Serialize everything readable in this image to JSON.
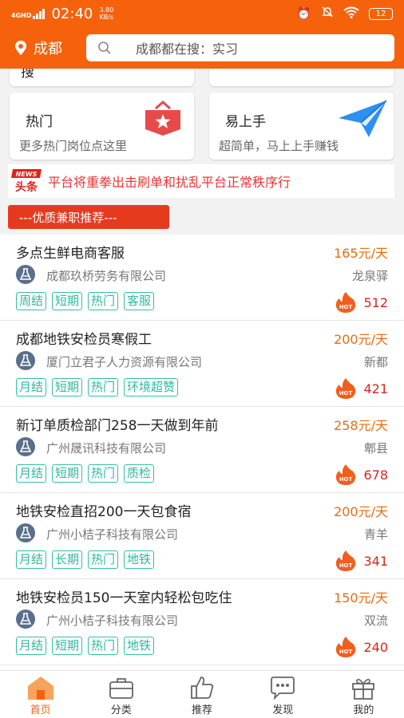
{
  "status": {
    "network": "4GHD",
    "time": "02:40",
    "speed_value": "3.80",
    "speed_unit": "KB/s",
    "battery": "12"
  },
  "header": {
    "city": "成都",
    "search_placeholder": "成都都在搜：实习"
  },
  "top_cards": {
    "partial_left": "搜"
  },
  "cards": [
    {
      "title": "热门",
      "subtitle": "更多热门岗位点这里",
      "icon": "star-badge-icon"
    },
    {
      "title": "易上手",
      "subtitle": "超简单，马上上手赚钱",
      "icon": "paper-plane-icon"
    }
  ],
  "notice": {
    "logo_top": "NEWS",
    "logo_bottom": "头条",
    "text": "平台将重拳出击刷单和扰乱平台正常秩序行"
  },
  "section_title": "---优质兼职推荐---",
  "jobs": [
    {
      "title": "多点生鲜电商客服",
      "salary": "165元/天",
      "company": "成都玖桥劳务有限公司",
      "location": "龙泉驿",
      "tags": [
        "周结",
        "短期",
        "热门",
        "客服"
      ],
      "hot": "512"
    },
    {
      "title": "成都地铁安检员寒假工",
      "salary": "200元/天",
      "company": "厦门立君子人力资源有限公司",
      "location": "新都",
      "tags": [
        "月结",
        "短期",
        "热门",
        "环境超赞"
      ],
      "hot": "421"
    },
    {
      "title": "新订单质检部门258一天做到年前",
      "salary": "258元/天",
      "company": "广州晟讯科技有限公司",
      "location": "郫县",
      "tags": [
        "月结",
        "短期",
        "热门",
        "质检"
      ],
      "hot": "678"
    },
    {
      "title": "地铁安检直招200一天包食宿",
      "salary": "200元/天",
      "company": "广州小桔子科技有限公司",
      "location": "青羊",
      "tags": [
        "月结",
        "长期",
        "热门",
        "地铁"
      ],
      "hot": "341"
    },
    {
      "title": "地铁安检员150一天室内轻松包吃住",
      "salary": "150元/天",
      "company": "广州小桔子科技有限公司",
      "location": "双流",
      "tags": [
        "月结",
        "短期",
        "热门",
        "地铁"
      ],
      "hot": "240"
    }
  ],
  "hot_badge": "HOT",
  "nav": [
    {
      "label": "首页",
      "icon": "home-icon"
    },
    {
      "label": "分类",
      "icon": "briefcase-icon"
    },
    {
      "label": "推荐",
      "icon": "thumbs-up-icon"
    },
    {
      "label": "发现",
      "icon": "chat-bubble-icon"
    },
    {
      "label": "我的",
      "icon": "gift-icon"
    }
  ],
  "colors": {
    "brand": "#f6620c",
    "salary": "#e76d0f",
    "tag": "#2fb89f",
    "hot": "#d9251c"
  }
}
